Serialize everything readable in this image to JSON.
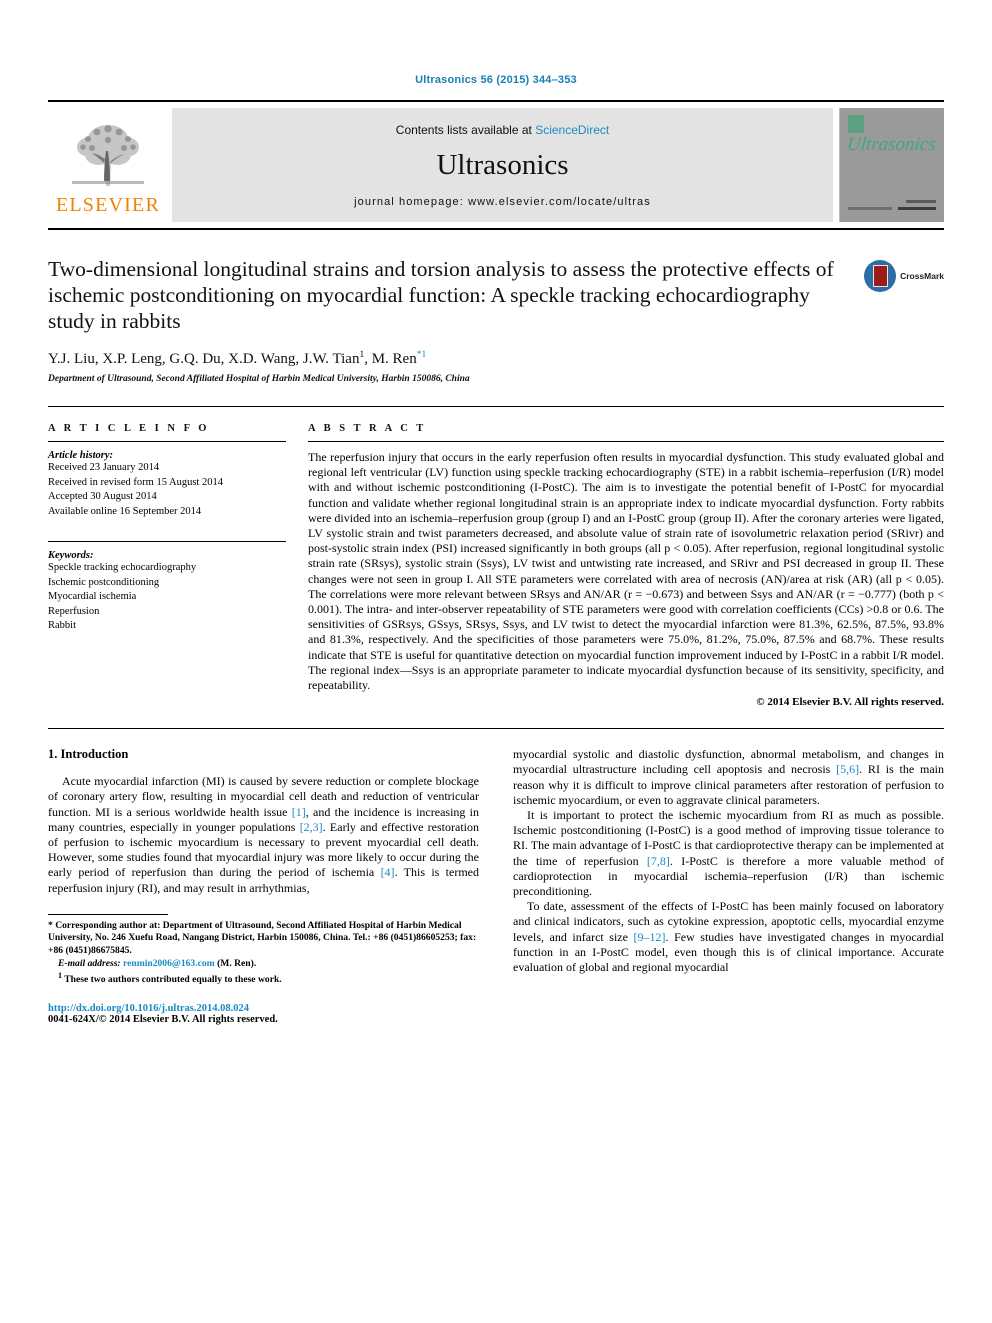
{
  "header": {
    "journal_ref": "Ultrasonics 56 (2015) 344–353",
    "contents_prefix": "Contents lists available at ",
    "sciencedirect": "ScienceDirect",
    "journal_name": "Ultrasonics",
    "homepage": "journal homepage: www.elsevier.com/locate/ultras",
    "publisher": "ELSEVIER",
    "cover_title": "Ultrasonics",
    "link_color": "#1a8ac4",
    "brand_orange": "#ef8200"
  },
  "article": {
    "title": "Two-dimensional longitudinal strains and torsion analysis to assess the protective effects of ischemic postconditioning on myocardial function: A speckle tracking echocardiography study in rabbits",
    "crossmark_label": "CrossMark",
    "authors": "Y.J. Liu, X.P. Leng, G.Q. Du, X.D. Wang, J.W. Tian",
    "author_sup_1": "1",
    "author_last": ", M. Ren",
    "author_sup_2": "*1",
    "affiliation": "Department of Ultrasound, Second Affiliated Hospital of Harbin Medical University, Harbin 150086, China"
  },
  "info": {
    "heading": "A R T I C L E  I N F O",
    "history_label": "Article history:",
    "history": [
      "Received 23 January 2014",
      "Received in revised form 15 August 2014",
      "Accepted 30 August 2014",
      "Available online 16 September 2014"
    ],
    "keywords_label": "Keywords:",
    "keywords": [
      "Speckle tracking echocardiography",
      "Ischemic postconditioning",
      "Myocardial ischemia",
      "Reperfusion",
      "Rabbit"
    ]
  },
  "abstract": {
    "heading": "A B S T R A C T",
    "text": "The reperfusion injury that occurs in the early reperfusion often results in myocardial dysfunction. This study evaluated global and regional left ventricular (LV) function using speckle tracking echocardiography (STE) in a rabbit ischemia–reperfusion (I/R) model with and without ischemic postconditioning (I-PostC). The aim is to investigate the potential benefit of I-PostC for myocardial function and validate whether regional longitudinal strain is an appropriate index to indicate myocardial dysfunction. Forty rabbits were divided into an ischemia–reperfusion group (group I) and an I-PostC group (group II). After the coronary arteries were ligated, LV systolic strain and twist parameters decreased, and absolute value of strain rate of isovolumetric relaxation period (SRivr) and post-systolic strain index (PSI) increased significantly in both groups (all p < 0.05). After reperfusion, regional longitudinal systolic strain rate (SRsys), systolic strain (Ssys), LV twist and untwisting rate increased, and SRivr and PSI decreased in group II. These changes were not seen in group I. All STE parameters were correlated with area of necrosis (AN)/area at risk (AR) (all p < 0.05). The correlations were more relevant between SRsys and AN/AR (r = −0.673) and between Ssys and AN/AR (r = −0.777) (both p < 0.001). The intra- and inter-observer repeatability of STE parameters were good with correlation coefficients (CCs) >0.8 or 0.6. The sensitivities of GSRsys, GSsys, SRsys, Ssys, and LV twist to detect the myocardial infarction were 81.3%, 62.5%, 87.5%, 93.8% and 81.3%, respectively. And the specificities of those parameters were 75.0%, 81.2%, 75.0%, 87.5% and 68.7%. These results indicate that STE is useful for quantitative detection on myocardial function improvement induced by I-PostC in a rabbit I/R model. The regional index—Ssys is an appropriate parameter to indicate myocardial dysfunction because of its sensitivity, specificity, and repeatability.",
    "copyright": "© 2014 Elsevier B.V. All rights reserved."
  },
  "introduction": {
    "heading": "1. Introduction",
    "left_p1_a": "Acute myocardial infarction (MI) is caused by severe reduction or complete blockage of coronary artery flow, resulting in myocardial cell death and reduction of ventricular function. MI is a serious worldwide health issue ",
    "left_cite_1": "[1]",
    "left_p1_b": ", and the incidence is increasing in many countries, especially in younger populations ",
    "left_cite_2": "[2,3]",
    "left_p1_c": ". Early and effective restoration of perfusion to ischemic myocardium is necessary to prevent myocardial cell death. However, some studies found that myocardial injury was more likely to occur during the early period of reperfusion than during the period of ischemia ",
    "left_cite_3": "[4]",
    "left_p1_d": ". This is termed reperfusion injury (RI), and may result in arrhythmias,",
    "right_p1_a": "myocardial systolic and diastolic dysfunction, abnormal metabolism, and changes in myocardial ultrastructure including cell apoptosis and necrosis ",
    "right_cite_1": "[5,6]",
    "right_p1_b": ". RI is the main reason why it is difficult to improve clinical parameters after restoration of perfusion to ischemic myocardium, or even to aggravate clinical parameters.",
    "right_p2_a": "It is important to protect the ischemic myocardium from RI as much as possible. Ischemic postconditioning (I-PostC) is a good method of improving tissue tolerance to RI. The main advantage of I-PostC is that cardioprotective therapy can be implemented at the time of reperfusion ",
    "right_cite_2": "[7,8]",
    "right_p2_b": ". I-PostC is therefore a more valuable method of cardioprotection in myocardial ischemia–reperfusion (I/R) than ischemic preconditioning.",
    "right_p3_a": "To date, assessment of the effects of I-PostC has been mainly focused on laboratory and clinical indicators, such as cytokine expression, apoptotic cells, myocardial enzyme levels, and infarct size ",
    "right_cite_3": "[9–12]",
    "right_p3_b": ". Few studies have investigated changes in myocardial function in an I-PostC model, even though this is of clinical importance. Accurate evaluation of global and regional myocardial"
  },
  "footnotes": {
    "corresponding_marker": "*",
    "corresponding": " Corresponding author at: Department of Ultrasound, Second Affiliated Hospital of Harbin Medical University, No. 246 Xuefu Road, Nangang District, Harbin 150086, China. Tel.: +86 (0451)86605253; fax: +86 (0451)86675845.",
    "email_label": "E-mail address:",
    "email": "renmin2006@163.com",
    "email_suffix": " (M. Ren).",
    "equal_marker": "1",
    "equal_contrib": " These two authors contributed equally to these work.",
    "doi": "http://dx.doi.org/10.1016/j.ultras.2014.08.024",
    "issn": "0041-624X/© 2014 Elsevier B.V. All rights reserved."
  }
}
